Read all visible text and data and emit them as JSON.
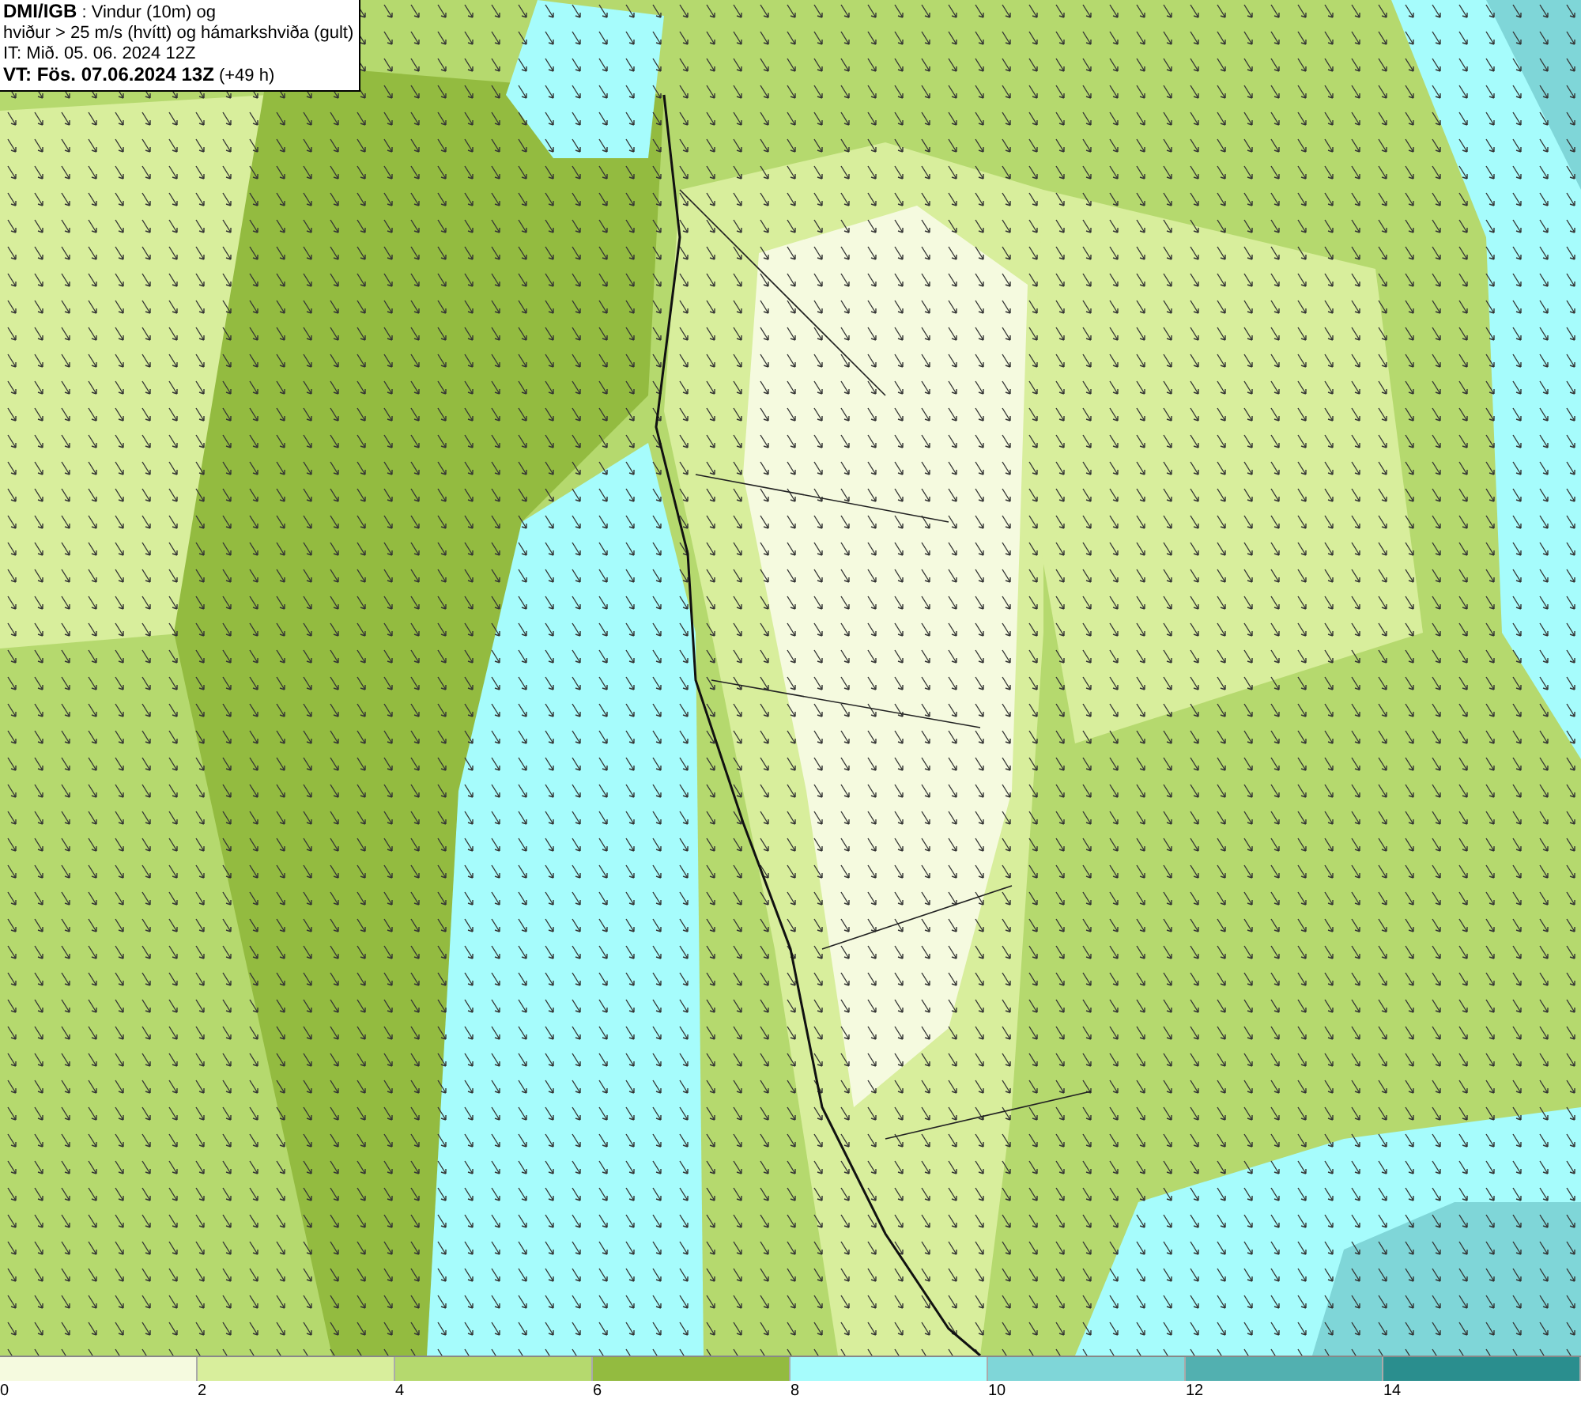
{
  "header": {
    "lines": [
      "**DMI/IGB** : Vindur (10m) og",
      "hviður > 25 m/s (hvítt) og hámarkshviða (gult)",
      "IT: Mið. 05. 06. 2024 12Z",
      "**VT: Fös. 07.06.2024 13Z** (+49 h)"
    ]
  },
  "legend": {
    "bins": [
      {
        "color": "#f5fadf"
      },
      {
        "color": "#d8ee9c"
      },
      {
        "color": "#b5d96e"
      },
      {
        "color": "#93bb40"
      },
      {
        "color": "#a6fcfc"
      },
      {
        "color": "#7fd6d8"
      },
      {
        "color": "#52b0b0"
      },
      {
        "color": "#2a8e8e"
      }
    ],
    "ticks": [
      "0",
      "2",
      "4",
      "6",
      "8",
      "10",
      "12",
      "14"
    ]
  }
}
